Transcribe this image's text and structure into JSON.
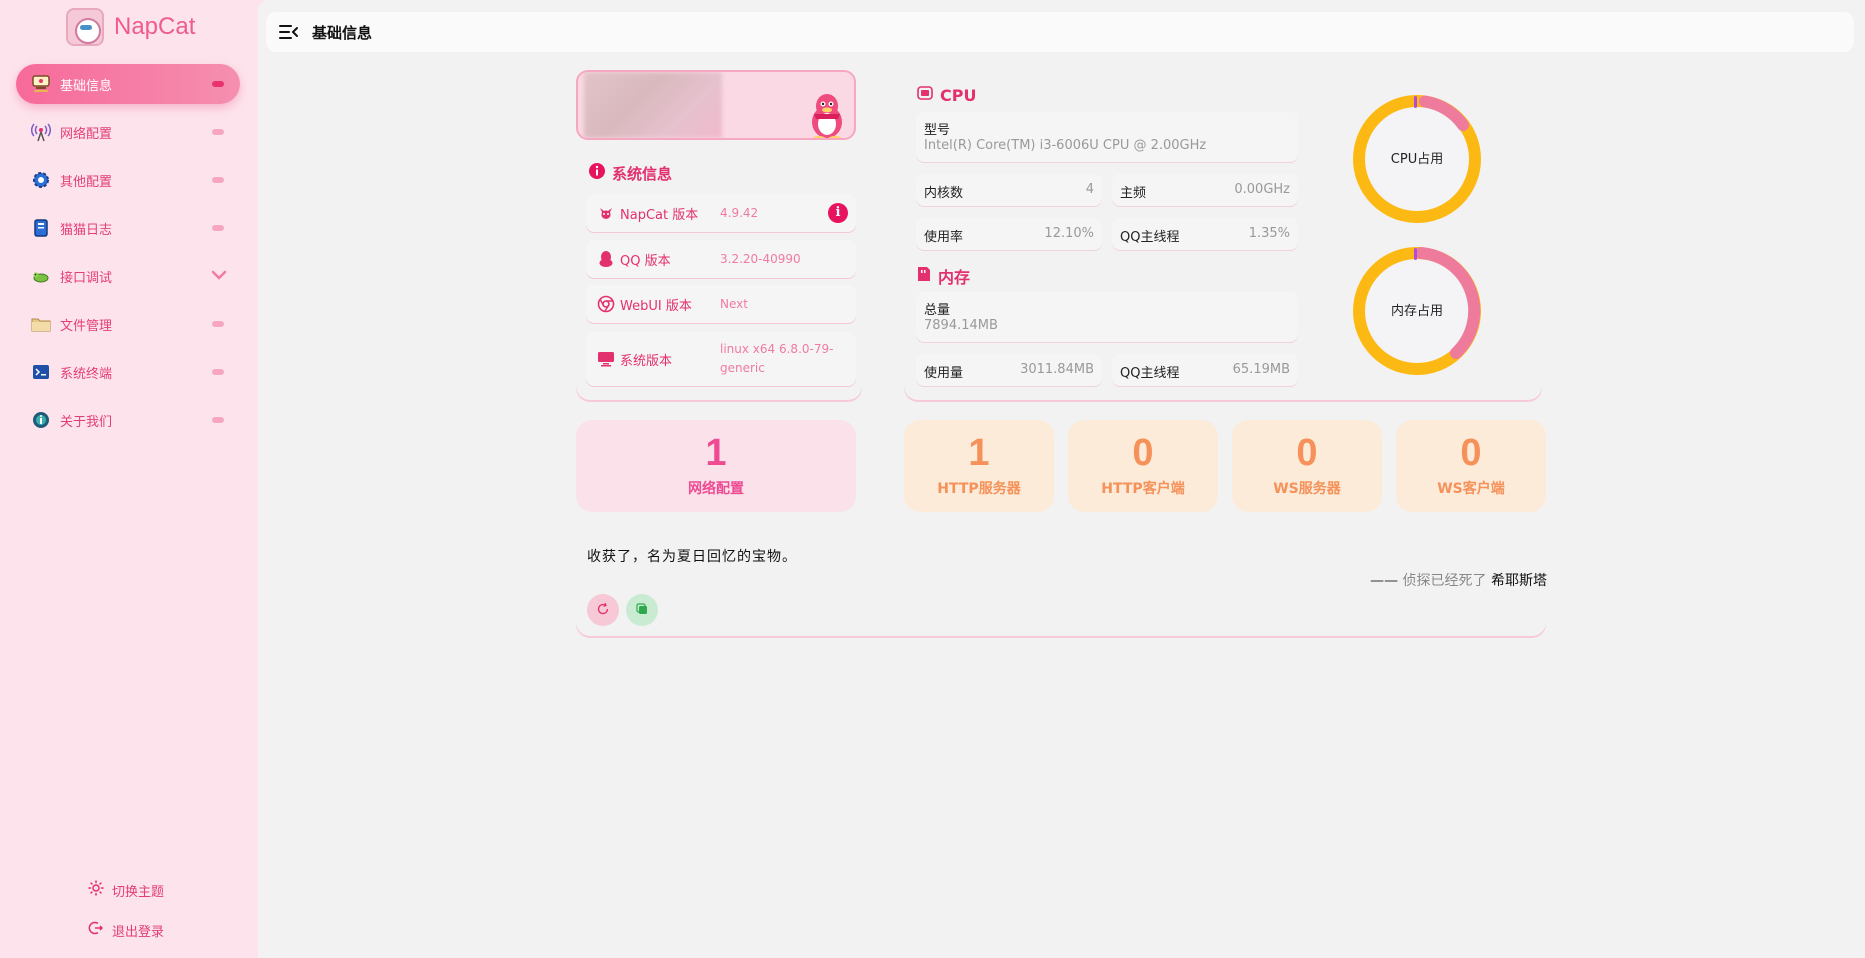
{
  "app": {
    "name": "NapCat"
  },
  "sidebar": {
    "items": [
      {
        "label": "基础信息",
        "icon": "dashboard-icon",
        "active": true
      },
      {
        "label": "网络配置",
        "icon": "antenna-icon"
      },
      {
        "label": "其他配置",
        "icon": "gear-icon"
      },
      {
        "label": "猫猫日志",
        "icon": "book-icon"
      },
      {
        "label": "接口调试",
        "icon": "bug-icon",
        "expandable": true
      },
      {
        "label": "文件管理",
        "icon": "folder-icon"
      },
      {
        "label": "系统终端",
        "icon": "terminal-icon"
      },
      {
        "label": "关于我们",
        "icon": "info-bubble-icon"
      }
    ],
    "theme_toggle": "切换主题",
    "logout": "退出登录"
  },
  "header": {
    "title": "基础信息"
  },
  "system_info": {
    "title": "系统信息",
    "rows": [
      {
        "key": "NapCat 版本",
        "value": "4.9.42"
      },
      {
        "key": "QQ 版本",
        "value": "3.2.20-40990"
      },
      {
        "key": "WebUI 版本",
        "value": "Next"
      },
      {
        "key": "系统版本",
        "value": "linux x64 6.8.0-79-generic"
      }
    ]
  },
  "cpu": {
    "title": "CPU",
    "model_label": "型号",
    "model": "Intel(R) Core(TM) i3-6006U CPU @ 2.00GHz",
    "cores_label": "内核数",
    "cores": "4",
    "freq_label": "主频",
    "freq": "0.00GHz",
    "usage_label": "使用率",
    "usage": "12.10%",
    "qq_label": "QQ主线程",
    "qq": "1.35%",
    "chart_label": "CPU占用"
  },
  "memory": {
    "title": "内存",
    "total_label": "总量",
    "total": "7894.14MB",
    "used_label": "使用量",
    "used": "3011.84MB",
    "qq_label": "QQ主线程",
    "qq": "65.19MB",
    "chart_label": "内存占用"
  },
  "counts": [
    {
      "value": "1",
      "label": "网络配置"
    },
    {
      "value": "1",
      "label": "HTTP服务器"
    },
    {
      "value": "0",
      "label": "HTTP客户端"
    },
    {
      "value": "0",
      "label": "WS服务器"
    },
    {
      "value": "0",
      "label": "WS客户端"
    }
  ],
  "quote": {
    "text": "收获了，名为夏日回忆的宝物。",
    "prefix": "——",
    "source": "侦探已经死了",
    "author": "希耶斯塔"
  },
  "colors": {
    "accent": "#ef5b8d",
    "orange": "#f59159",
    "donut_yellow": "#fdb913",
    "donut_pink": "#ee7b9c"
  }
}
